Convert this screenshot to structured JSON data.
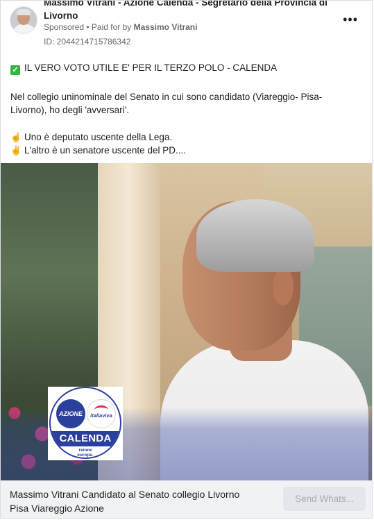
{
  "header": {
    "page_name": "Massimo Vitrani - Azione Calenda - Segretario della Provincia di Livorno",
    "sponsored_label": "Sponsored",
    "paid_for_prefix": "• Paid for by",
    "payer": "Massimo Vitrani",
    "ad_id": "ID: 2044214715786342",
    "more_icon": "more-options-icon"
  },
  "body": {
    "headline": "IL VERO VOTO UTILE E' PER IL TERZO POLO - CALENDA",
    "paragraph_line1": "Nel collegio uninominale del Senato in cui sono candidato (Viareggio- Pisa-",
    "paragraph_line2": "Livorno), ho degli 'avversari'.",
    "bullet1": "Uno è deputato uscente della Lega.",
    "bullet2": "L'altro è un senatore uscente del PD...."
  },
  "image": {
    "logo": {
      "left_text": "AZIONE",
      "right_text": "italiaviva",
      "band_text": "CALENDA",
      "sub_line1": "renew",
      "sub_line2": "europe."
    }
  },
  "footer": {
    "title_line1": "Massimo Vitrani Candidato al Senato collegio Livorno",
    "title_line2": "Pisa Viareggio Azione",
    "cta_label": "Send Whats..."
  },
  "colors": {
    "brand_blue": "#2b3f9c",
    "check_green": "#2db742"
  }
}
